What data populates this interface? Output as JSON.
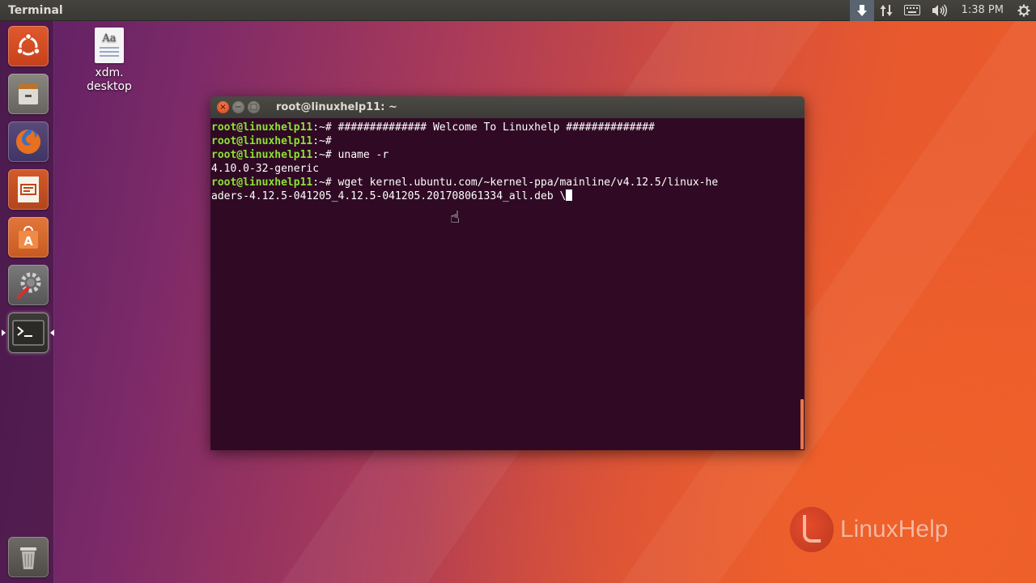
{
  "top_panel": {
    "app_title": "Terminal",
    "clock": "1:38 PM",
    "icons": [
      "download-icon",
      "network-updown-icon",
      "keyboard-icon",
      "volume-icon",
      "settings-gear-icon"
    ]
  },
  "launcher": {
    "items": [
      {
        "name": "ubuntu-dash",
        "icon": "ubuntu-logo-icon"
      },
      {
        "name": "files",
        "icon": "file-cabinet-icon"
      },
      {
        "name": "firefox",
        "icon": "firefox-icon"
      },
      {
        "name": "libreoffice-impress",
        "icon": "presentation-icon"
      },
      {
        "name": "ubuntu-software",
        "icon": "software-bag-icon"
      },
      {
        "name": "system-settings",
        "icon": "wrench-gear-icon"
      },
      {
        "name": "terminal",
        "icon": "terminal-icon"
      },
      {
        "name": "trash",
        "icon": "trash-icon"
      }
    ]
  },
  "desktop": {
    "icon_label_line1": "xdm.",
    "icon_label_line2": "desktop",
    "doc_glyph": "Aa"
  },
  "terminal": {
    "window_title": "root@linuxhelp11: ~",
    "prompt": "root@linuxhelp11",
    "prompt_suffix": ":~# ",
    "lines": {
      "l1_cmd": "############## Welcome To Linuxhelp ##############",
      "l2_cmd": "",
      "l3_cmd": "uname -r",
      "l4_out": "4.10.0-32-generic",
      "l5_cmd": "wget kernel.ubuntu.com/~kernel-ppa/mainline/v4.12.5/linux-he",
      "l6_cont": "aders-4.12.5-041205_4.12.5-041205.201708061334_all.deb \\"
    }
  },
  "watermark": {
    "text": "LinuxHelp"
  },
  "colors": {
    "terminal_bg": "#300a24",
    "prompt_green": "#8ae234",
    "panel_bg": "#3c3b37",
    "accent_orange": "#e95420"
  }
}
